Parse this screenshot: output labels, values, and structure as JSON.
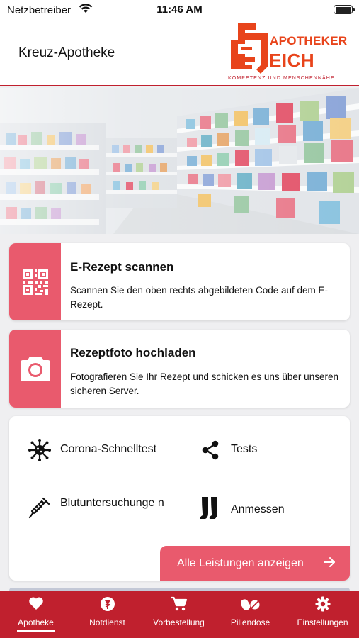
{
  "status_bar": {
    "carrier": "Netzbetreiber",
    "time": "11:46 AM"
  },
  "header": {
    "title": "Kreuz-Apotheke",
    "logo": {
      "line1": "APOTHEKER",
      "line2": "EICH",
      "tagline": "KOMPETENZ UND MENSCHENNÄHE",
      "color": "#e8441b"
    }
  },
  "hero": {
    "icon": "pharmacy-shelves-photo"
  },
  "cards": [
    {
      "icon": "qr-code-icon",
      "title": "E-Rezept scannen",
      "description": "Scannen Sie den oben rechts abgebildeten Code auf dem E-Rezept."
    },
    {
      "icon": "camera-icon",
      "title": "Rezeptfoto hochladen",
      "description": "Fotografieren Sie Ihr Rezept und schicken es uns über unseren sicheren Server."
    }
  ],
  "services": {
    "items": [
      {
        "icon": "virus-icon",
        "label": "Corona-Schnelltest"
      },
      {
        "icon": "share-icon",
        "label": "Tests"
      },
      {
        "icon": "syringe-icon",
        "label": "Blutuntersuchunge n"
      },
      {
        "icon": "stockings-icon",
        "label": "Anmessen"
      }
    ],
    "all_button": "Alle Leistungen anzeigen"
  },
  "tabs": [
    {
      "icon": "heart-icon",
      "label": "Apotheke",
      "active": true
    },
    {
      "icon": "emergency-icon",
      "label": "Notdienst",
      "active": false
    },
    {
      "icon": "cart-icon",
      "label": "Vorbestellung",
      "active": false
    },
    {
      "icon": "pill-icon",
      "label": "Pillendose",
      "active": false
    },
    {
      "icon": "gear-icon",
      "label": "Einstellungen",
      "active": false
    }
  ],
  "colors": {
    "brand": "#c0202e",
    "accent": "#e95a6d",
    "logo": "#e8441b"
  }
}
